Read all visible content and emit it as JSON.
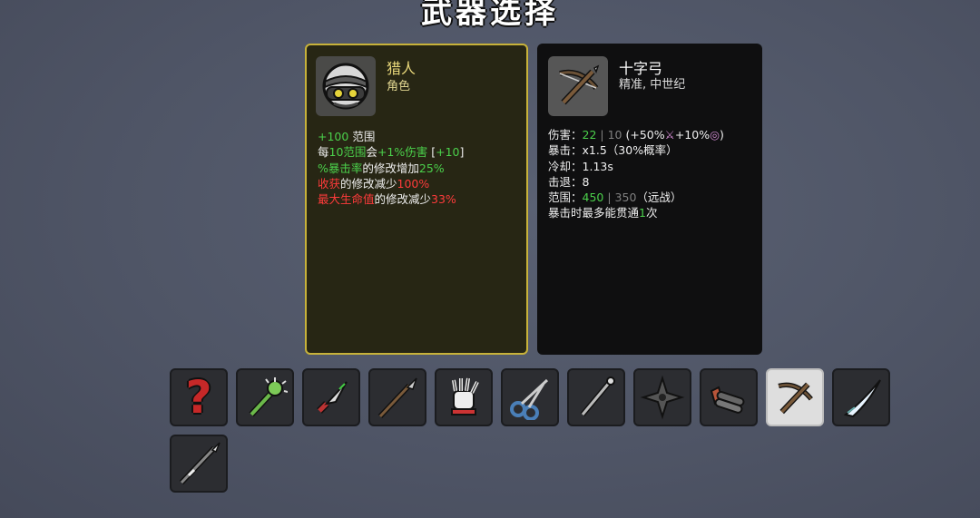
{
  "title": "武器选择",
  "character": {
    "name": "猎人",
    "type": "角色",
    "stats": {
      "line1": {
        "value": "+100",
        "label": " 范围"
      },
      "line2": {
        "a": "每",
        "b": "10范围",
        "c": "会",
        "d": "+1%伤害",
        "e": " [",
        "f": "+10",
        "g": "]"
      },
      "line3": {
        "a": "%暴击率",
        "b": "的修改增加",
        "c": "25%"
      },
      "line4": {
        "a": "收获",
        "b": "的修改减少",
        "c": "100%"
      },
      "line5": {
        "a": "最大生命值",
        "b": "的修改减少",
        "c": "33%"
      }
    }
  },
  "weapon": {
    "name": "十字弓",
    "type": "精准, 中世纪",
    "stats": {
      "damage": {
        "label": "伤害：",
        "value": "22",
        "sep": " | ",
        "base": "10",
        "bonus_a": " (+50%",
        "bonus_b": "+10%",
        "close": ")"
      },
      "crit": {
        "label": "暴击：",
        "value": "x1.5（30%概率）"
      },
      "cooldown": {
        "label": "冷却：",
        "value": "1.13s"
      },
      "knockback": {
        "label": "击退：",
        "value": "8"
      },
      "range": {
        "label": "范围：",
        "value": "450",
        "sep": " | ",
        "base": "350",
        "suffix": "（远战）"
      },
      "pierce": {
        "a": "暴击时最多能贯通",
        "b": "1",
        "c": "次"
      }
    }
  },
  "slots": [
    {
      "name": "random-weapon",
      "icon": "question-mark-icon",
      "selected": false
    },
    {
      "name": "spiked-club",
      "icon": "spiked-club-icon",
      "selected": false
    },
    {
      "name": "knife",
      "icon": "knife-icon",
      "selected": false
    },
    {
      "name": "spear",
      "icon": "spear-icon",
      "selected": false
    },
    {
      "name": "claw-glove",
      "icon": "claw-glove-icon",
      "selected": false
    },
    {
      "name": "scissors",
      "icon": "scissors-icon",
      "selected": false
    },
    {
      "name": "rod",
      "icon": "rod-icon",
      "selected": false
    },
    {
      "name": "shuriken",
      "icon": "shuriken-icon",
      "selected": false
    },
    {
      "name": "double-barrel",
      "icon": "double-barrel-icon",
      "selected": false
    },
    {
      "name": "crossbow",
      "icon": "crossbow-icon",
      "selected": true
    },
    {
      "name": "ice-fang",
      "icon": "ice-fang-icon",
      "selected": false
    },
    {
      "name": "sniper-spear",
      "icon": "sniper-spear-icon",
      "selected": false
    }
  ]
}
